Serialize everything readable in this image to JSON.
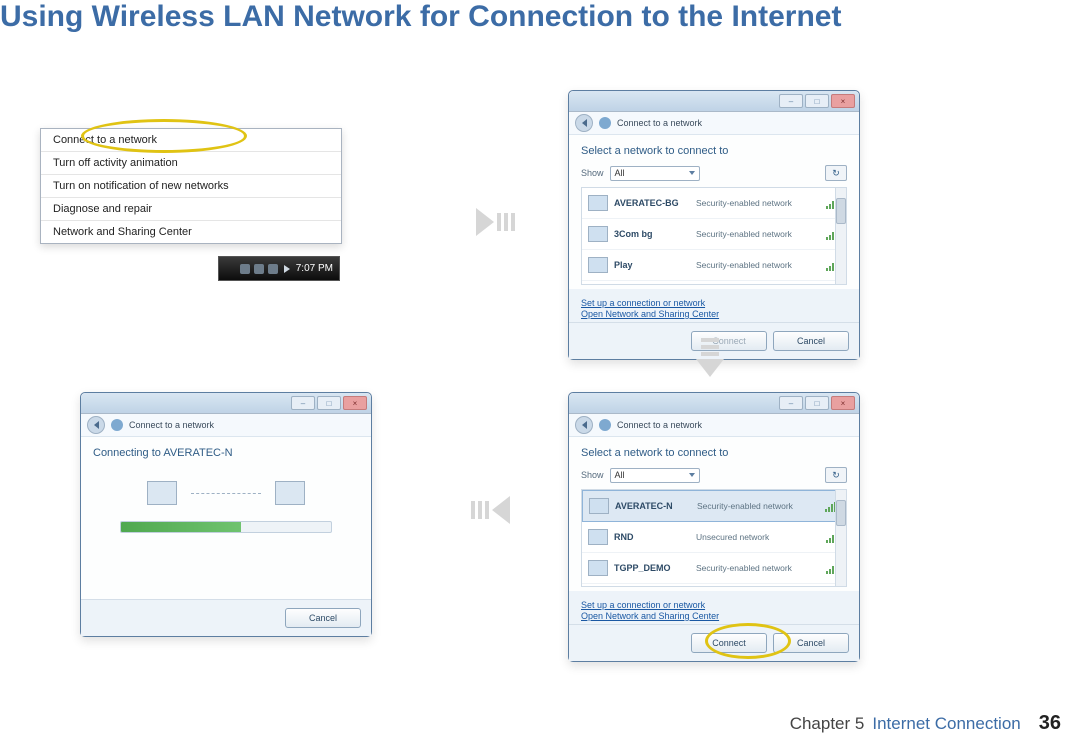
{
  "page_title": "Using Wireless LAN Network for Connection to the Internet",
  "footer": {
    "chapter": "Chapter 5",
    "section": "Internet Connection",
    "page": "36"
  },
  "menu": {
    "items": [
      "Connect to a network",
      "Turn off activity animation",
      "Turn on notification of new networks",
      "Diagnose and repair",
      "Network and Sharing Center"
    ],
    "clock": "7:07 PM"
  },
  "dialog_common": {
    "nav_title": "Connect to a network",
    "select_heading": "Select a network to connect to",
    "show_label": "Show",
    "show_value": "All",
    "refresh_glyph": "↻",
    "link1": "Set up a connection or network",
    "link2": "Open Network and Sharing Center",
    "btn_connect": "Connect",
    "btn_cancel": "Cancel"
  },
  "dialog2_networks": [
    {
      "name": "AVERATEC-BG",
      "desc": "Security-enabled network"
    },
    {
      "name": "3Com bg",
      "desc": "Security-enabled network"
    },
    {
      "name": "Play",
      "desc": "Security-enabled network"
    }
  ],
  "dialog3_networks": [
    {
      "name": "AVERATEC-N",
      "desc": "Security-enabled network"
    },
    {
      "name": "RND",
      "desc": "Unsecured network"
    },
    {
      "name": "TGPP_DEMO",
      "desc": "Security-enabled network"
    }
  ],
  "dialog4": {
    "heading": "Connecting to AVERATEC-N"
  }
}
